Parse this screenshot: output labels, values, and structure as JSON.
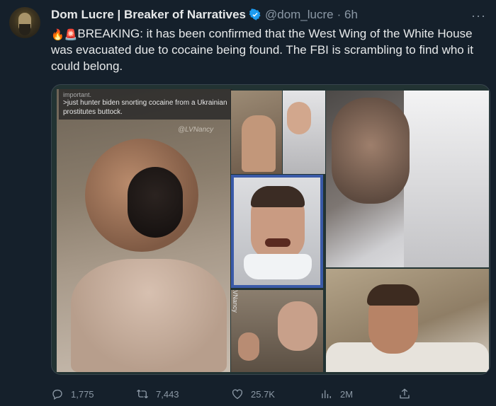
{
  "tweet": {
    "author_name": "Dom Lucre | Breaker of Narratives",
    "handle": "@dom_lucre",
    "time": "· 6h",
    "more_label": "···",
    "emoji_fire": "🔥",
    "emoji_siren": "🚨",
    "text": "BREAKING: it has been confirmed that the West Wing of the White House was evacuated due to cocaine being found. The FBI is scrambling to find who it could belong.",
    "accent_color": "#1d9bf0"
  },
  "media": {
    "caption_line0": "important.",
    "caption_line1": ">just hunter biden snorting cocaine from a Ukrainian prostitutes buttock.",
    "watermark": "@LVNancy",
    "side_watermark": "LVNancy"
  },
  "actions": {
    "reply_count": "1,775",
    "retweet_count": "7,443",
    "like_count": "25.7K",
    "views_count": "2M"
  },
  "icons": {
    "verified": "verified-badge-icon",
    "reply": "reply-icon",
    "retweet": "retweet-icon",
    "like": "like-icon",
    "views": "views-icon",
    "share": "share-icon"
  }
}
